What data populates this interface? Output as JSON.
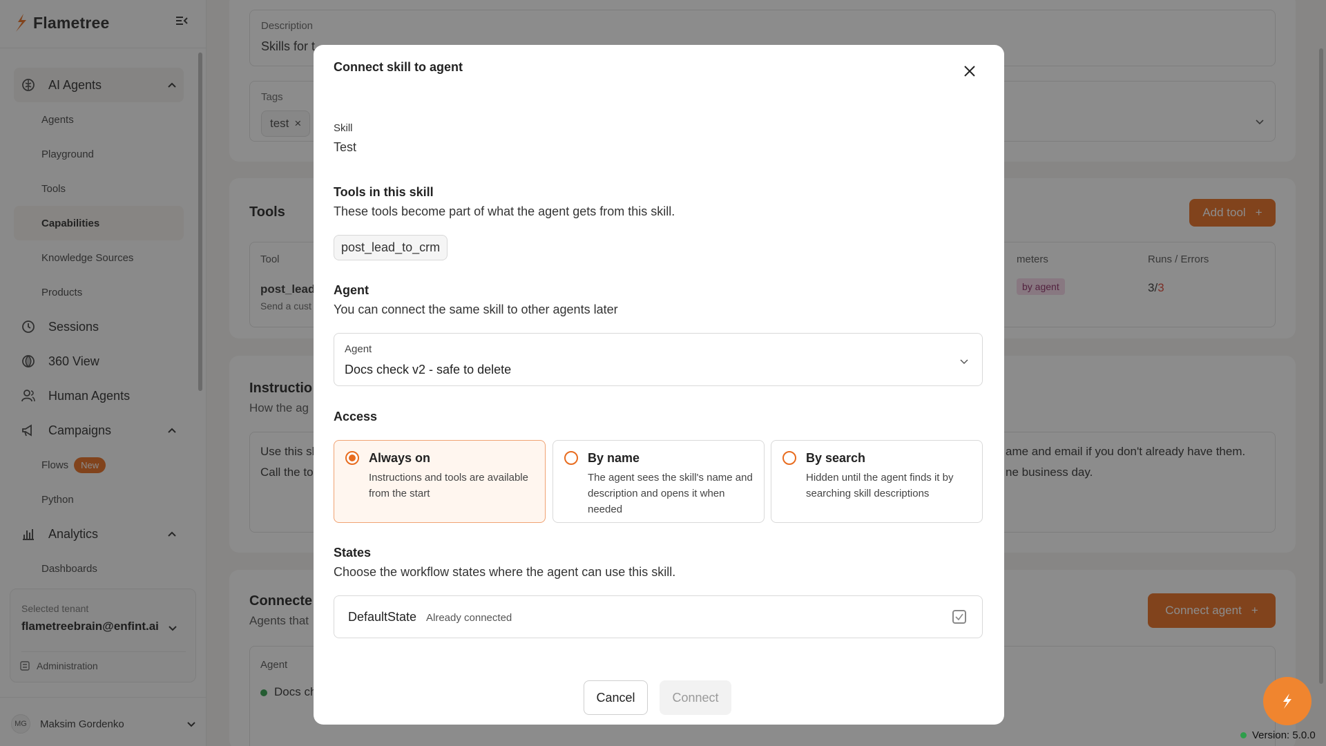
{
  "app": {
    "brand": "Flametree",
    "colors": {
      "accent": "#e86c1f",
      "fab": "#f0852f",
      "status_green": "#2e9e4b"
    }
  },
  "sidebar": {
    "groups": [
      {
        "label": "AI Agents",
        "icon": "brain-icon"
      },
      {
        "label": "Sessions",
        "icon": "history-icon"
      },
      {
        "label": "360 View",
        "icon": "globe-icon"
      },
      {
        "label": "Human Agents",
        "icon": "users-icon"
      },
      {
        "label": "Campaigns",
        "icon": "megaphone-icon"
      },
      {
        "label": "Analytics",
        "icon": "bar-chart-icon"
      }
    ],
    "ai_agents_items": [
      "Agents",
      "Playground",
      "Tools",
      "Capabilities",
      "Knowledge Sources",
      "Products"
    ],
    "campaigns_items": [
      "Flows",
      "Python"
    ],
    "flows_badge": "New",
    "analytics_items": [
      "Dashboards"
    ],
    "tenant": {
      "label": "Selected tenant",
      "value": "flametreebrain@enfint.ai",
      "admin": "Administration"
    },
    "user": {
      "initials": "MG",
      "name": "Maksim Gordenko"
    }
  },
  "background": {
    "description_label": "Description",
    "description_value": "Skills for t",
    "tags_label": "Tags",
    "tag": "test",
    "tools_title": "Tools",
    "add_tool": "Add tool",
    "tools_table": {
      "col_tool": "Tool",
      "col_parameters": "meters",
      "col_runs": "Runs / Errors",
      "row_name": "post_lead",
      "row_desc": "Send a cust",
      "row_badge": "by agent",
      "runs": "3/",
      "errors": "3"
    },
    "instructions_title": "Instructio",
    "instructions_sub": "How the ag",
    "instructions_line1": "Use this sl",
    "instructions_line2": "Call the to",
    "instructions_right1": "ame and email if you don't already have them.",
    "instructions_right2": "ne business day.",
    "connected_title": "Connecte",
    "connected_sub": "Agents that",
    "connect_agent": "Connect agent",
    "connected_col": "Agent",
    "connected_row": "Docs ch"
  },
  "modal": {
    "title": "Connect skill to agent",
    "skill_label": "Skill",
    "skill_value": "Test",
    "tools_heading": "Tools in this skill",
    "tools_desc": "These tools become part of what the agent gets from this skill.",
    "tool_chip": "post_lead_to_crm",
    "agent_heading": "Agent",
    "agent_desc": "You can connect the same skill to other agents later",
    "agent_select_label": "Agent",
    "agent_select_value": "Docs check v2 - safe to delete",
    "access_heading": "Access",
    "access_options": [
      {
        "title": "Always on",
        "desc": "Instructions and tools are available from the start",
        "selected": true
      },
      {
        "title": "By name",
        "desc": "The agent sees the skill's name and description and opens it when needed",
        "selected": false
      },
      {
        "title": "By search",
        "desc": "Hidden until the agent finds it by searching skill descriptions",
        "selected": false
      }
    ],
    "states_heading": "States",
    "states_desc": "Choose the workflow states where the agent can use this skill.",
    "state_name": "DefaultState",
    "state_note": "Already connected",
    "cancel": "Cancel",
    "connect": "Connect"
  },
  "footer": {
    "version": "Version: 5.0.0"
  }
}
